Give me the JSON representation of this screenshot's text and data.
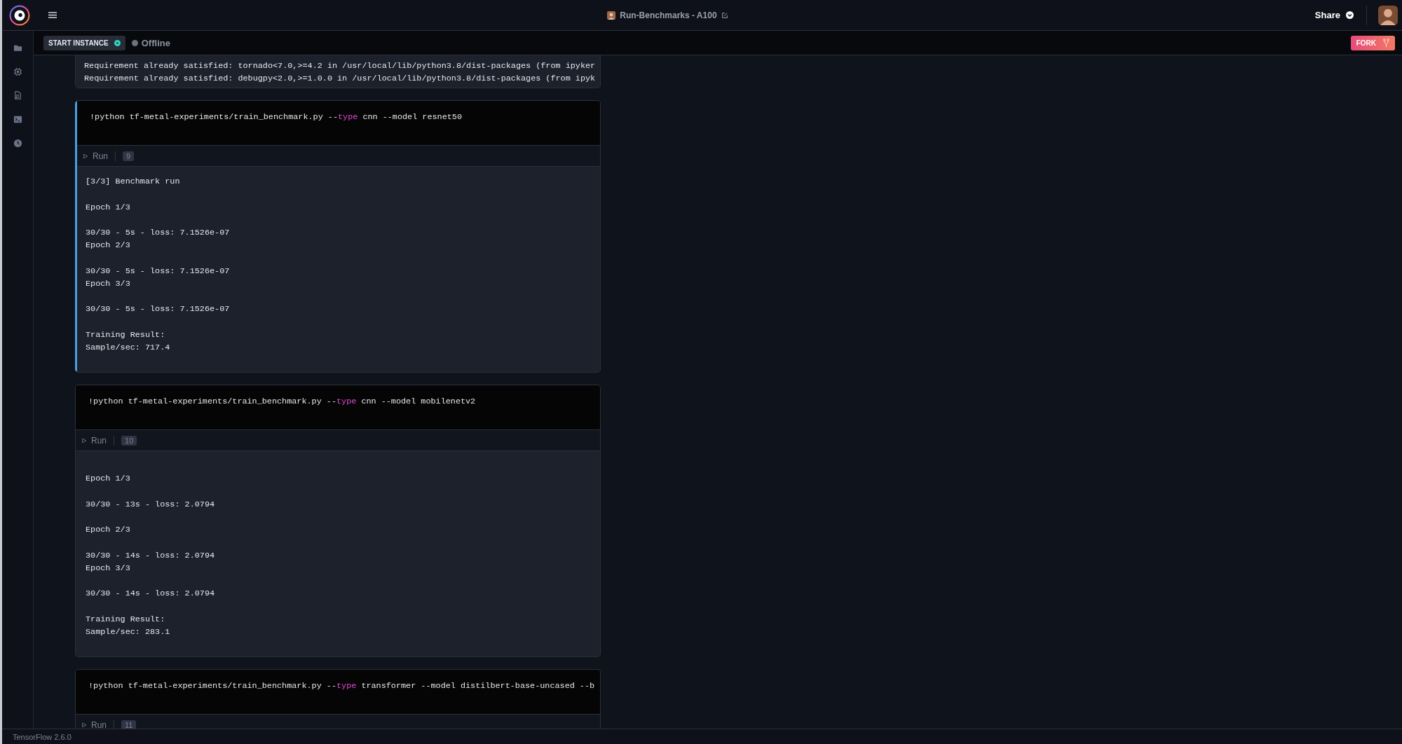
{
  "header": {
    "title": "Run-Benchmarks - A100",
    "share_label": "Share"
  },
  "toolbar": {
    "start_label": "START INSTANCE",
    "status": "Offline",
    "fork_label": "FORK"
  },
  "cells": [
    {
      "kind": "output_only",
      "selected": false,
      "output": "Requirement already satisfied: tornado<7.0,>=4.2 in /usr/local/lib/python3.8/dist-packages (from ipyker\nRequirement already satisfied: debugpy<2.0,>=1.0.0 in /usr/local/lib/python3.8/dist-packages (from ipyk"
    },
    {
      "kind": "code",
      "selected": true,
      "code": [
        {
          "text": "!python tf-metal-experiments/train_benchmark.py --",
          "kind": "plain"
        },
        {
          "text": "type",
          "kind": "keyword"
        },
        {
          "text": " cnn --model resnet50",
          "kind": "plain"
        }
      ],
      "run_label": "Run",
      "count": "9",
      "output": "[3/3] Benchmark run\n\nEpoch 1/3\n\n30/30 - 5s - loss: 7.1526e-07\nEpoch 2/3\n\n30/30 - 5s - loss: 7.1526e-07\nEpoch 3/3\n\n30/30 - 5s - loss: 7.1526e-07\n\nTraining Result:\nSample/sec: 717.4"
    },
    {
      "kind": "code",
      "selected": false,
      "code": [
        {
          "text": "!python tf-metal-experiments/train_benchmark.py --",
          "kind": "plain"
        },
        {
          "text": "type",
          "kind": "keyword"
        },
        {
          "text": " cnn --model mobilenetv2",
          "kind": "plain"
        }
      ],
      "run_label": "Run",
      "count": "10",
      "output": "\nEpoch 1/3\n\n30/30 - 13s - loss: 2.0794\n\nEpoch 2/3\n\n30/30 - 14s - loss: 2.0794\nEpoch 3/3\n\n30/30 - 14s - loss: 2.0794\n\nTraining Result:\nSample/sec: 283.1"
    },
    {
      "kind": "code",
      "selected": false,
      "code": [
        {
          "text": "!python tf-metal-experiments/train_benchmark.py --",
          "kind": "plain"
        },
        {
          "text": "type",
          "kind": "keyword"
        },
        {
          "text": " transformer --model distilbert-base-uncased --b",
          "kind": "plain"
        }
      ],
      "run_label": "Run",
      "count": "11"
    }
  ],
  "status_bar": {
    "text": "TensorFlow 2.6.0"
  }
}
